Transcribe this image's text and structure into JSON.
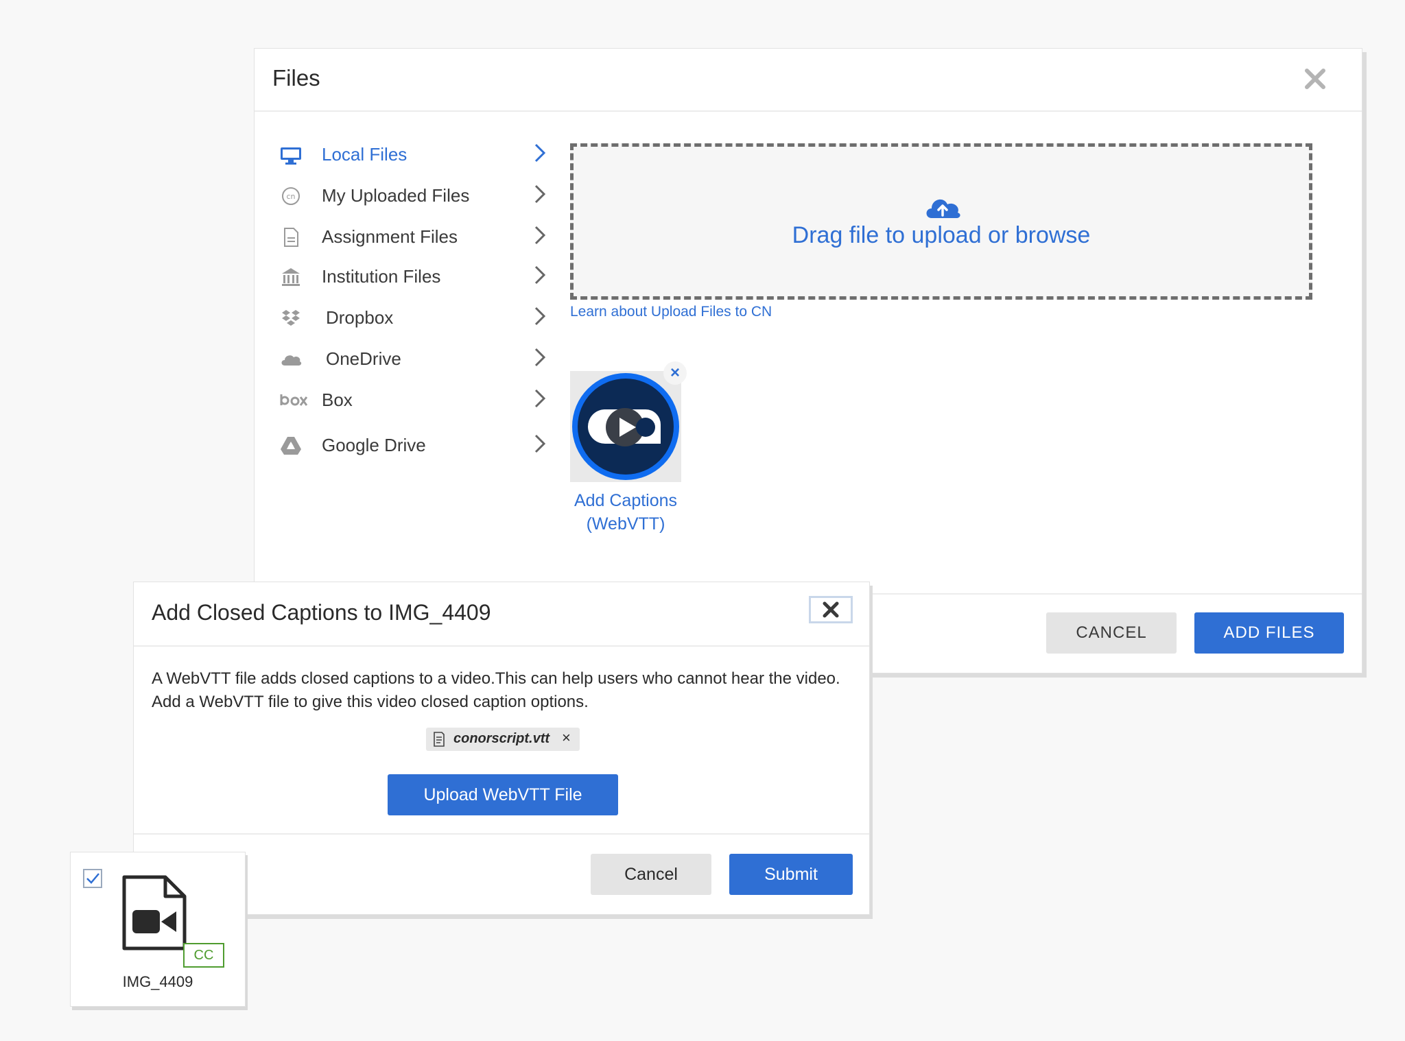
{
  "files_dialog": {
    "title": "Files",
    "nav": [
      {
        "label": "Local Files",
        "icon": "monitor-icon"
      },
      {
        "label": "My Uploaded Files",
        "icon": "cn-icon"
      },
      {
        "label": "Assignment Files",
        "icon": "document-icon"
      },
      {
        "label": "Institution Files",
        "icon": "institution-icon"
      },
      {
        "label": "Dropbox",
        "icon": "dropbox-icon"
      },
      {
        "label": "OneDrive",
        "icon": "cloud-icon"
      },
      {
        "label": "Box",
        "icon": "box-logo-icon"
      },
      {
        "label": "Google Drive",
        "icon": "google-drive-icon"
      }
    ],
    "dropzone_text": "Drag file to upload or browse",
    "learn_link": "Learn about Upload Files to CN",
    "tile_label_line1": "Add Captions",
    "tile_label_line2": "(WebVTT)",
    "cancel": "CANCEL",
    "add_files": "ADD FILES"
  },
  "captions_dialog": {
    "title": "Add Closed Captions to IMG_4409",
    "description": "A WebVTT file adds closed captions to a video.This can help users who cannot hear the video. Add a WebVTT file to give this video closed caption options.",
    "attached_file": "conorscript.vtt",
    "upload_button": "Upload WebVTT File",
    "cancel": "Cancel",
    "submit": "Submit"
  },
  "file_card": {
    "name": "IMG_4409",
    "badge": "CC",
    "checked": true
  },
  "colors": {
    "accent": "#2f6fd4",
    "cc_badge": "#4f9c2f",
    "tile_ring": "#0f6cf0",
    "tile_fill": "#0c2a55"
  }
}
